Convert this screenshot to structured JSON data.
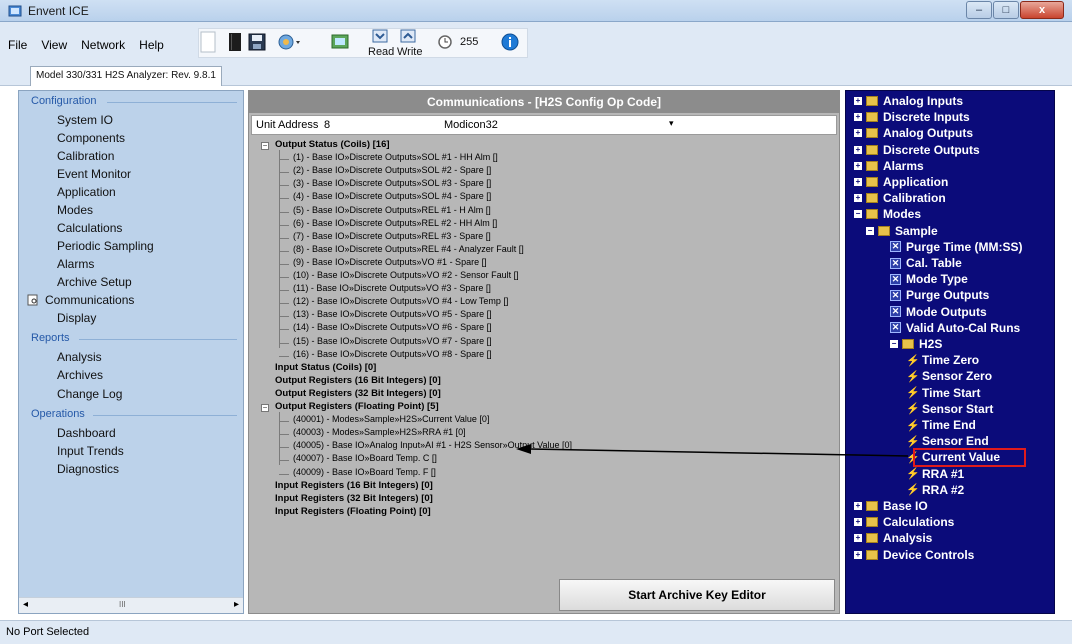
{
  "window": {
    "title": "Envent ICE",
    "min_glyph": "–",
    "max_glyph": "□",
    "close_glyph": "x"
  },
  "menu": [
    "File",
    "View",
    "Network",
    "Help"
  ],
  "toolbar": {
    "read_label": "Read",
    "write_label": "Write",
    "count_value": "255"
  },
  "model_tab": "Model 330/331 H2S Analyzer: Rev. 9.8.1",
  "sidebar": {
    "configuration_header": "Configuration",
    "configuration_items": [
      "System IO",
      "Components",
      "Calibration",
      "Event Monitor",
      "Application",
      "Modes",
      "Calculations",
      "Periodic Sampling",
      "Alarms",
      "Archive Setup",
      "Communications",
      "Display"
    ],
    "reports_header": "Reports",
    "reports_items": [
      "Analysis",
      "Archives",
      "Change Log"
    ],
    "operations_header": "Operations",
    "operations_items": [
      "Dashboard",
      "Input Trends",
      "Diagnostics"
    ],
    "active_item": "Communications",
    "scroll_glyph": "III"
  },
  "center": {
    "header": "Communications - [H2S Config Op Code]",
    "unit_address_label": "Unit Address",
    "unit_address_value": "8",
    "protocol": "Modicon32",
    "tree": [
      {
        "text": "Output Status (Coils) [16]",
        "bold": true,
        "level": 0,
        "expand": "−"
      },
      {
        "text": "(1) - Base IO»Discrete Outputs»SOL #1 - HH Alm []",
        "level": 1
      },
      {
        "text": "(2) - Base IO»Discrete Outputs»SOL #2 - Spare []",
        "level": 1
      },
      {
        "text": "(3) - Base IO»Discrete Outputs»SOL #3 - Spare []",
        "level": 1
      },
      {
        "text": "(4) - Base IO»Discrete Outputs»SOL #4 - Spare []",
        "level": 1
      },
      {
        "text": "(5) - Base IO»Discrete Outputs»REL #1 - H Alm []",
        "level": 1
      },
      {
        "text": "(6) - Base IO»Discrete Outputs»REL #2 - HH Alm []",
        "level": 1
      },
      {
        "text": "(7) - Base IO»Discrete Outputs»REL #3 - Spare []",
        "level": 1
      },
      {
        "text": "(8) - Base IO»Discrete Outputs»REL #4 - Analyzer Fault []",
        "level": 1
      },
      {
        "text": "(9) - Base IO»Discrete Outputs»VO #1 - Spare []",
        "level": 1
      },
      {
        "text": "(10) - Base IO»Discrete Outputs»VO #2 - Sensor Fault []",
        "level": 1
      },
      {
        "text": "(11) - Base IO»Discrete Outputs»VO #3 - Spare []",
        "level": 1
      },
      {
        "text": "(12) - Base IO»Discrete Outputs»VO #4 - Low Temp []",
        "level": 1
      },
      {
        "text": "(13) - Base IO»Discrete Outputs»VO #5 - Spare []",
        "level": 1
      },
      {
        "text": "(14) - Base IO»Discrete Outputs»VO #6 - Spare []",
        "level": 1
      },
      {
        "text": "(15) - Base IO»Discrete Outputs»VO #7 - Spare []",
        "level": 1
      },
      {
        "text": "(16) - Base IO»Discrete Outputs»VO #8 - Spare []",
        "level": 1
      },
      {
        "text": "Input Status (Coils) [0]",
        "bold": true,
        "level": 0
      },
      {
        "text": "Output Registers (16 Bit Integers) [0]",
        "bold": true,
        "level": 0
      },
      {
        "text": "Output Registers (32 Bit Integers) [0]",
        "bold": true,
        "level": 0
      },
      {
        "text": "Output Registers (Floating Point) [5]",
        "bold": true,
        "level": 0,
        "expand": "−"
      },
      {
        "text": "(40001) - Modes»Sample»H2S»Current Value [0]",
        "level": 1
      },
      {
        "text": "(40003) - Modes»Sample»H2S»RRA #1 [0]",
        "level": 1
      },
      {
        "text": "(40005) - Base IO»Analog Input»AI #1 - H2S Sensor»Output Value [0]",
        "level": 1
      },
      {
        "text": "(40007) - Base IO»Board Temp. C []",
        "level": 1
      },
      {
        "text": "(40009) - Base IO»Board Temp. F []",
        "level": 1
      },
      {
        "text": "Input Registers (16 Bit Integers) [0]",
        "bold": true,
        "level": 0
      },
      {
        "text": "Input Registers (32 Bit Integers) [0]",
        "bold": true,
        "level": 0
      },
      {
        "text": "Input Registers (Floating Point) [0]",
        "bold": true,
        "level": 0
      }
    ],
    "archive_button": "Start Archive Key Editor"
  },
  "right_tree": [
    {
      "text": "Analog Inputs",
      "kind": "folder",
      "level": 0,
      "pm": "+"
    },
    {
      "text": "Discrete Inputs",
      "kind": "folder",
      "level": 0,
      "pm": "+"
    },
    {
      "text": "Analog Outputs",
      "kind": "folder",
      "level": 0,
      "pm": "+"
    },
    {
      "text": "Discrete Outputs",
      "kind": "folder",
      "level": 0,
      "pm": "+"
    },
    {
      "text": "Alarms",
      "kind": "folder",
      "level": 0,
      "pm": "+"
    },
    {
      "text": "Application",
      "kind": "folder",
      "level": 0,
      "pm": "+"
    },
    {
      "text": "Calibration",
      "kind": "folder",
      "level": 0,
      "pm": "+"
    },
    {
      "text": "Modes",
      "kind": "folder",
      "level": 0,
      "pm": "−"
    },
    {
      "text": "Sample",
      "kind": "folder",
      "level": 1,
      "pm": "−"
    },
    {
      "text": "Purge Time (MM:SS)",
      "kind": "x",
      "level": 2
    },
    {
      "text": "Cal. Table",
      "kind": "x",
      "level": 2
    },
    {
      "text": "Mode Type",
      "kind": "x",
      "level": 2
    },
    {
      "text": "Purge Outputs",
      "kind": "x",
      "level": 2
    },
    {
      "text": "Mode Outputs",
      "kind": "x",
      "level": 2
    },
    {
      "text": "Valid Auto-Cal Runs",
      "kind": "x",
      "level": 2
    },
    {
      "text": "H2S",
      "kind": "folder",
      "level": 2,
      "pm": "−"
    },
    {
      "text": "Time Zero",
      "kind": "bolt",
      "level": 3
    },
    {
      "text": "Sensor Zero",
      "kind": "bolt",
      "level": 3
    },
    {
      "text": "Time Start",
      "kind": "bolt",
      "level": 3
    },
    {
      "text": "Sensor Start",
      "kind": "bolt",
      "level": 3
    },
    {
      "text": "Time End",
      "kind": "bolt",
      "level": 3
    },
    {
      "text": "Sensor End",
      "kind": "bolt",
      "level": 3
    },
    {
      "text": "Current Value",
      "kind": "bolt",
      "level": 3
    },
    {
      "text": "RRA #1",
      "kind": "bolt",
      "level": 3
    },
    {
      "text": "RRA #2",
      "kind": "bolt",
      "level": 3
    },
    {
      "text": "Base IO",
      "kind": "folder",
      "level": 0,
      "pm": "+"
    },
    {
      "text": "Calculations",
      "kind": "folder",
      "level": 0,
      "pm": "+"
    },
    {
      "text": "Analysis",
      "kind": "folder",
      "level": 0,
      "pm": "+"
    },
    {
      "text": "Device Controls",
      "kind": "folder",
      "level": 0,
      "pm": "+"
    }
  ],
  "highlighted_node": "Current Value",
  "status_text": "No Port Selected",
  "colors": {
    "right_panel_bg": "#0b0b7a",
    "highlight_border": "#e01b1b",
    "left_panel_bg": "#bcd2ea",
    "center_panel_bg": "#b7b7b7"
  },
  "icons": {
    "toolbar": [
      "document-icon",
      "book-icon",
      "save-icon",
      "network-icon",
      "connect-icon",
      "read-icon",
      "write-icon",
      "timer-icon",
      "info-icon"
    ],
    "tree": [
      "folder-icon",
      "x-setting-icon",
      "bolt-icon"
    ]
  }
}
